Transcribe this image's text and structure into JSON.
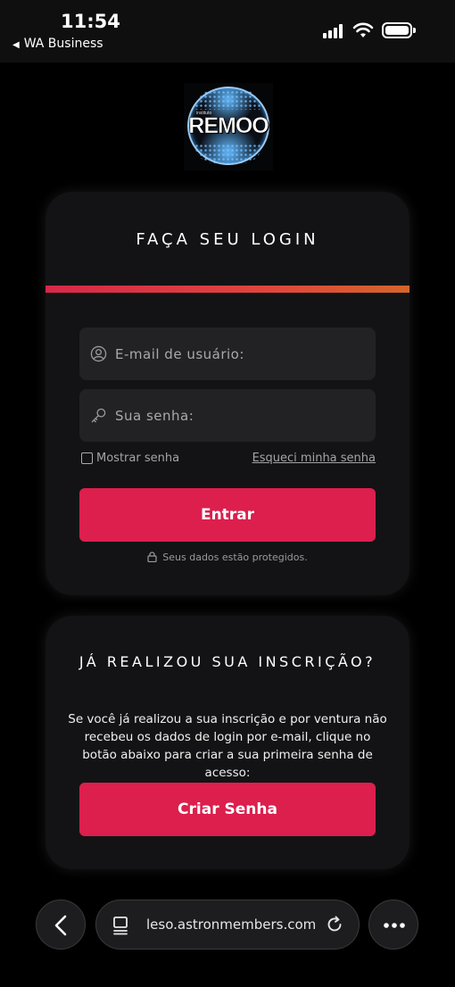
{
  "status_bar": {
    "time": "11:54",
    "back_app": "WA Business"
  },
  "logo": {
    "brand": "REMOO",
    "tagline": "instituto"
  },
  "login": {
    "title": "FAÇA SEU LOGIN",
    "email_placeholder": "E-mail de usuário:",
    "password_placeholder": "Sua senha:",
    "show_password": "Mostrar senha",
    "forgot_password": "Esqueci minha senha",
    "submit": "Entrar",
    "secure_note": "Seus dados estão protegidos."
  },
  "signup": {
    "title": "JÁ REALIZOU SUA INSCRIÇÃO?",
    "text": "Se você já realizou a sua inscrição e por ventura não recebeu os dados de login por e-mail, clique no botão abaixo para criar a sua primeira senha de acesso:",
    "button": "Criar Senha"
  },
  "browser": {
    "url": "leso.astronmembers.com"
  },
  "colors": {
    "accent": "#dc1f4d",
    "card_bg": "#131315",
    "field_bg": "#222224"
  }
}
